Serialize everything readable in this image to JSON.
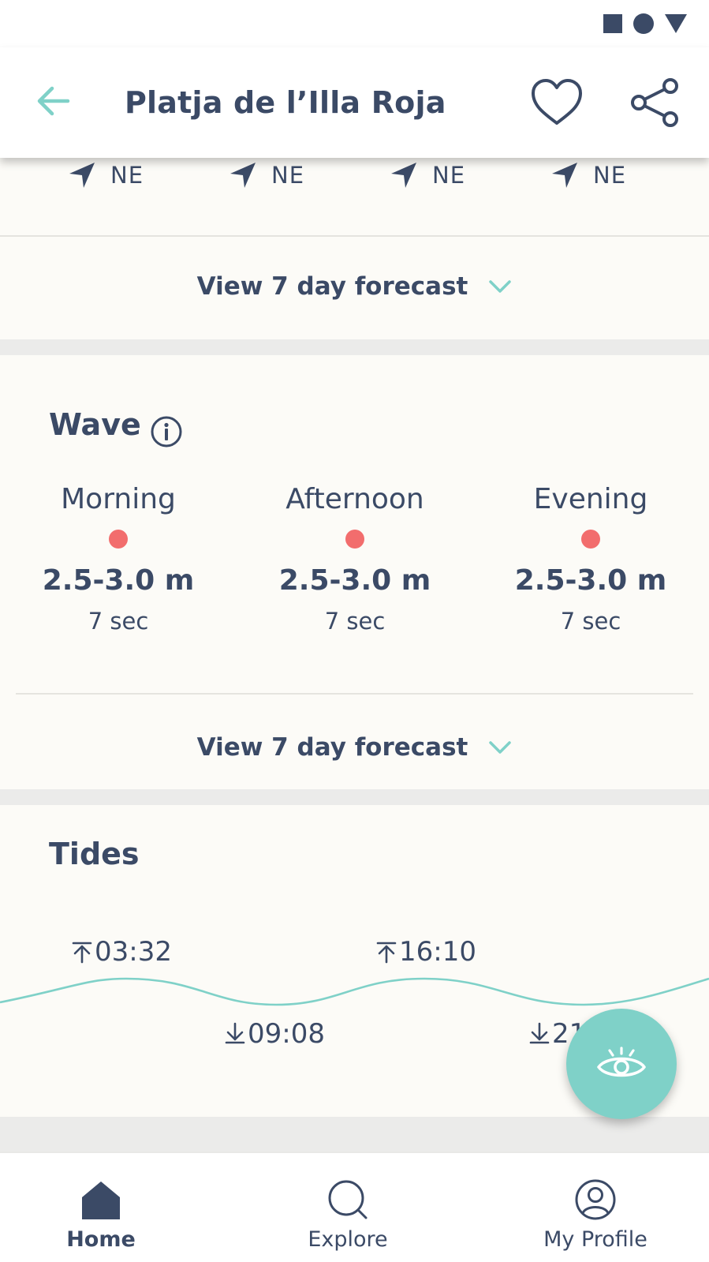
{
  "header": {
    "title": "Platja de l’Illa Roja",
    "back_icon": "arrow-left-icon",
    "favorite_icon": "heart-icon",
    "share_icon": "share-icon"
  },
  "wind": {
    "directions": [
      "NE",
      "NE",
      "NE",
      "NE"
    ],
    "forecast_label": "View 7 day forecast"
  },
  "wave": {
    "title": "Wave",
    "periods": [
      {
        "label": "Morning",
        "height": "2.5-3.0 m",
        "period": "7 sec"
      },
      {
        "label": "Afternoon",
        "height": "2.5-3.0 m",
        "period": "7 sec"
      },
      {
        "label": "Evening",
        "height": "2.5-3.0 m",
        "period": "7 sec"
      }
    ],
    "forecast_label": "View 7 day forecast"
  },
  "tides": {
    "title": "Tides",
    "high": [
      "03:32",
      "16:10"
    ],
    "low": [
      "09:08",
      "21"
    ]
  },
  "nav": {
    "home": "Home",
    "explore": "Explore",
    "profile": "My Profile"
  },
  "colors": {
    "primary": "#3b4a66",
    "accent": "#7fd1c8",
    "wave_dot": "#f26d6d",
    "card_bg": "#fcfbf7"
  }
}
